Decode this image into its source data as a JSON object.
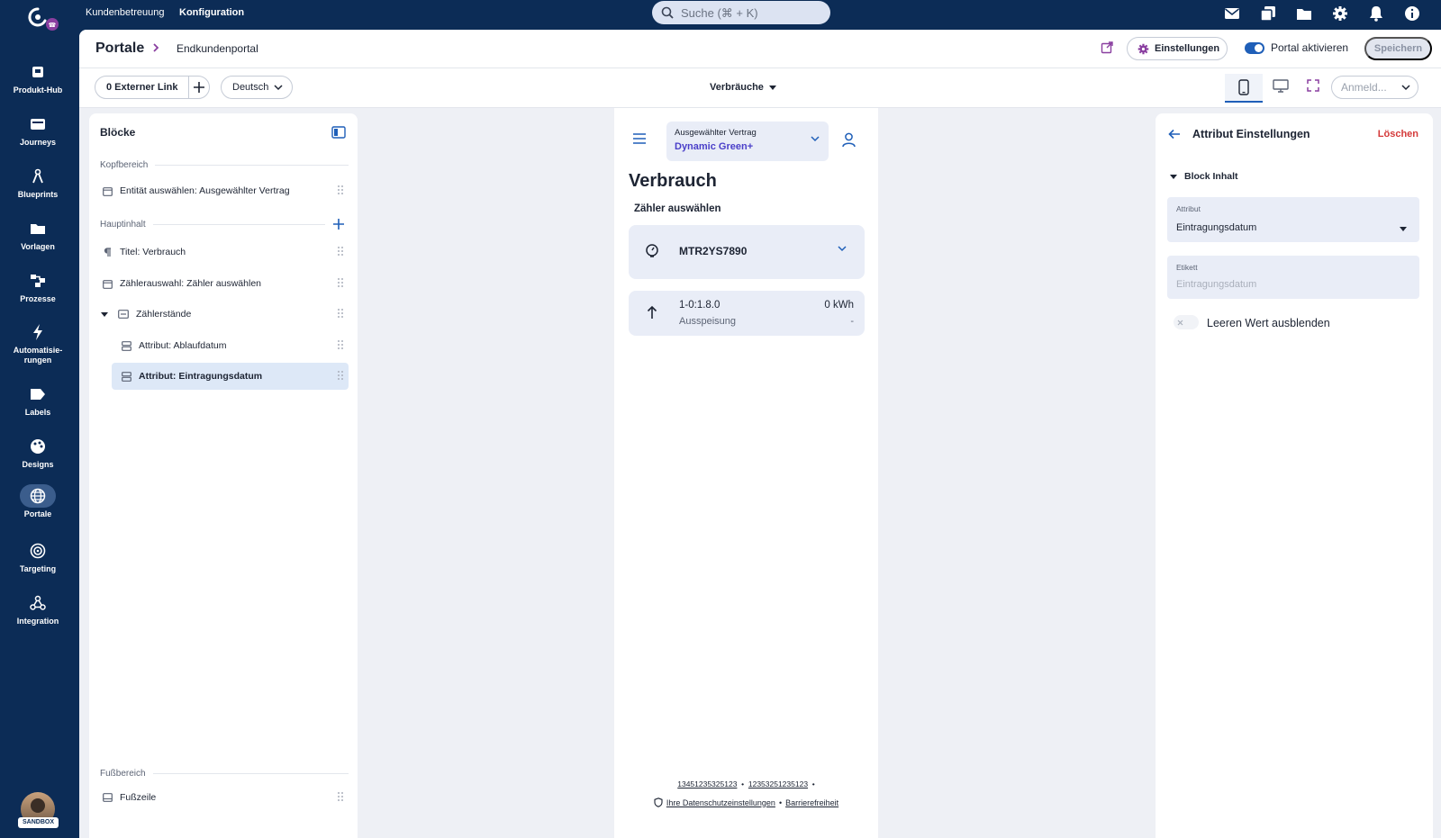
{
  "topnav": {
    "links": [
      "Kundenbetreuung",
      "Konfiguration"
    ],
    "search_placeholder": "Suche (⌘ + K)",
    "icons": [
      "mail-icon",
      "copy-icon",
      "folder-icon",
      "gear-icon",
      "bell-icon",
      "info-icon"
    ]
  },
  "sidebar": {
    "items": [
      {
        "label": "Produkt-Hub",
        "icon": "shop-icon"
      },
      {
        "label": "Journeys",
        "icon": "journey-icon"
      },
      {
        "label": "Blueprints",
        "icon": "compass-icon"
      },
      {
        "label": "Vorlagen",
        "icon": "folder-icon"
      },
      {
        "label": "Prozesse",
        "icon": "process-icon"
      },
      {
        "label": "Automatisie-\nrungen",
        "icon": "bolt-icon"
      },
      {
        "label": "Labels",
        "icon": "label-icon"
      },
      {
        "label": "Designs",
        "icon": "palette-icon"
      },
      {
        "label": "Portale",
        "icon": "globe-icon",
        "active": true
      },
      {
        "label": "Targeting",
        "icon": "target-icon"
      },
      {
        "label": "Integration",
        "icon": "webhook-icon"
      }
    ],
    "badge": "SANDBOX"
  },
  "header": {
    "breadcrumb_root": "Portale",
    "breadcrumb_leaf": "Endkundenportal",
    "settings_label": "Einstellungen",
    "portal_toggle_label": "Portal aktivieren",
    "save_label": "Speichern"
  },
  "toolbar": {
    "external_link_label": "0 Externer Link",
    "language": "Deutsch",
    "page": "Verbräuche",
    "login_placeholder": "Anmeld..."
  },
  "blocks": {
    "title": "Blöcke",
    "sections": {
      "header": "Kopfbereich",
      "main": "Hauptinhalt",
      "footer": "Fußbereich"
    },
    "header_items": [
      "Entität auswählen: Ausgewählter Vertrag"
    ],
    "main_items": [
      "Titel: Verbrauch",
      "Zählerauswahl: Zähler auswählen",
      "Zählerstände",
      "Attribut: Ablaufdatum",
      "Attribut: Eintragungsdatum"
    ],
    "footer_items": [
      "Fußzeile"
    ]
  },
  "preview": {
    "contract_label": "Ausgewählter Vertrag",
    "contract_value": "Dynamic Green+",
    "title": "Verbrauch",
    "meter_select_label": "Zähler auswählen",
    "meter_id": "MTR2YS7890",
    "reading_code": "1-0:1.8.0",
    "reading_type": "Ausspeisung",
    "reading_value": "0 kWh",
    "reading_dash": "-",
    "footer_phone1": "13451235325123",
    "footer_phone2": "12353251235123",
    "footer_privacy": "Ihre Datenschutzeinstellungen",
    "footer_accessibility": "Barrierefreiheit"
  },
  "attribute_panel": {
    "title": "Attribut Einstellungen",
    "delete_label": "Löschen",
    "group_label": "Block Inhalt",
    "attribute_label": "Attribut",
    "attribute_value": "Eintragungsdatum",
    "tag_label": "Etikett",
    "tag_placeholder": "Eintragungsdatum",
    "hide_empty_label": "Leeren Wert ausblenden"
  }
}
